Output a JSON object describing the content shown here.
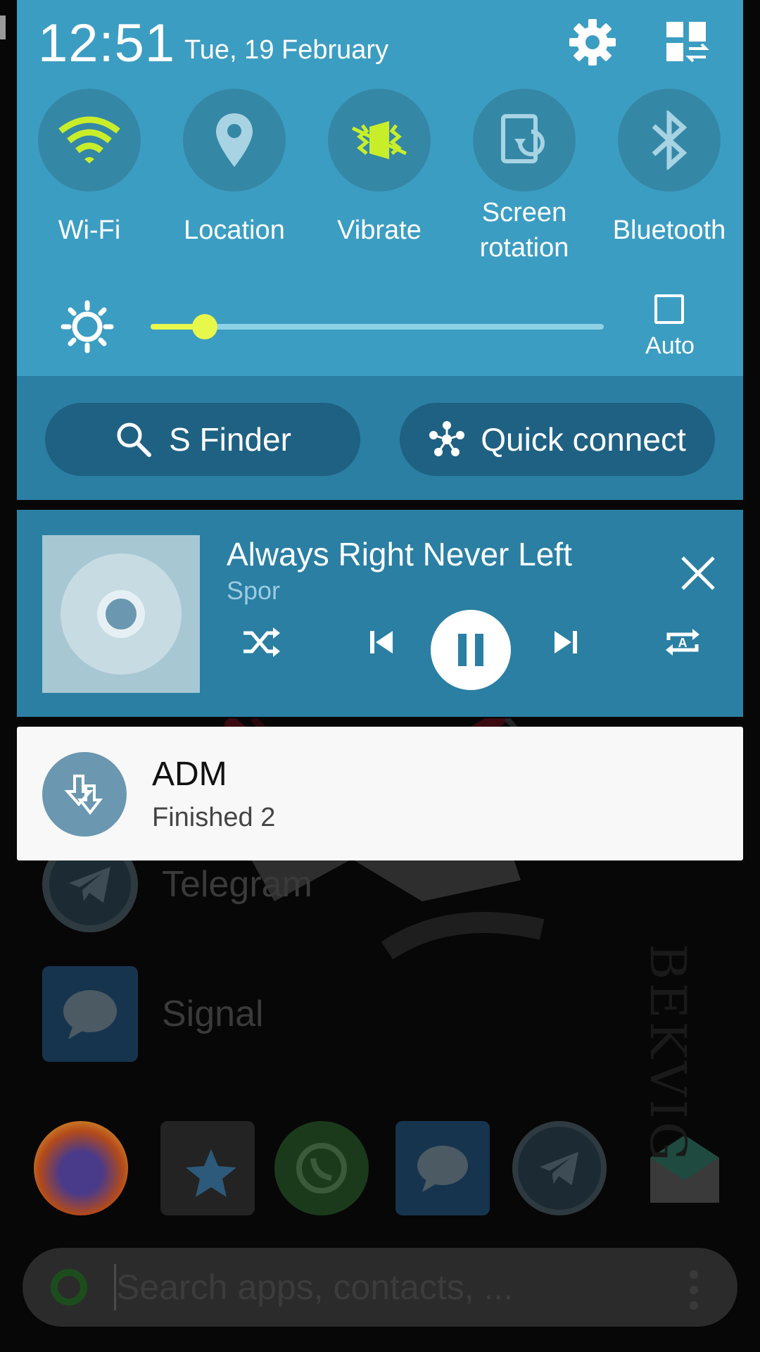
{
  "status": {
    "time": "12:51",
    "date": "Tue, 19 February"
  },
  "header_icons": [
    "gear-icon",
    "edit-tiles-icon"
  ],
  "quick_settings": [
    {
      "label": "Wi-Fi",
      "icon": "wifi-icon",
      "active": true
    },
    {
      "label": "Location",
      "icon": "location-pin-icon",
      "active": false
    },
    {
      "label": "Vibrate",
      "icon": "vibrate-icon",
      "active": true
    },
    {
      "label": "Screen\nrotation",
      "icon": "screen-rotation-icon",
      "active": false
    },
    {
      "label": "Bluetooth",
      "icon": "bluetooth-icon",
      "active": false
    }
  ],
  "brightness": {
    "level": 0.12,
    "auto_label": "Auto",
    "auto_checked": false
  },
  "buttons": {
    "s_finder": "S Finder",
    "quick_connect": "Quick connect"
  },
  "media": {
    "title": "Always Right Never Left",
    "artist": "Spor",
    "state": "playing"
  },
  "notification": {
    "app": "ADM",
    "text": "Finished 2"
  },
  "background": {
    "apps": [
      "Telegram",
      "Signal"
    ],
    "search_placeholder": "Search apps, contacts, ..."
  },
  "colors": {
    "panel": "#3c9dc2",
    "panel_dark": "#2a7fa3",
    "accent": "#e8f84a"
  }
}
